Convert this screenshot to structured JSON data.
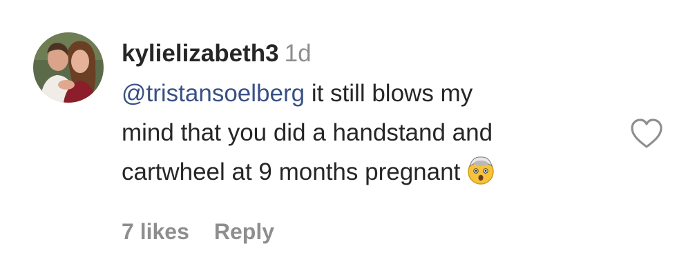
{
  "comment": {
    "username": "kylielizabeth3",
    "time": "1d",
    "mention": "@tristansoelberg",
    "line1_rest": " it still blows my",
    "line2": "mind that you did a handstand and",
    "line3": "cartwheel at 9 months pregnant",
    "emoji": "exploding-head-emoji",
    "likes": "7 likes",
    "reply_label": "Reply"
  },
  "colors": {
    "username": "#262626",
    "text": "#262626",
    "mention": "#385185",
    "muted": "#8e8e8e"
  },
  "icons": {
    "like": "heart-outline-icon"
  }
}
